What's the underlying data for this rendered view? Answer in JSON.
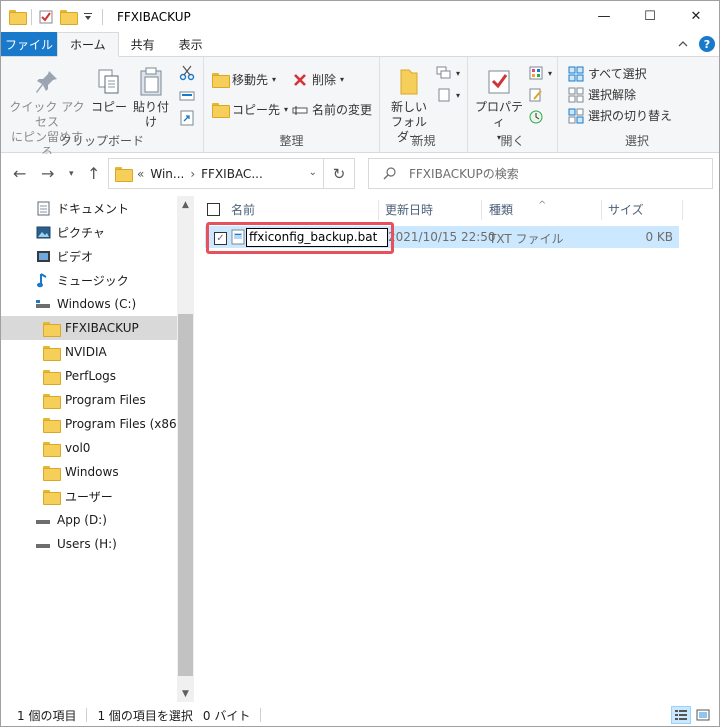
{
  "window": {
    "title": "FFXIBACKUP",
    "controls": {
      "minimize": "—",
      "maximize": "☐",
      "close": "✕"
    }
  },
  "tabs": [
    {
      "label": "ファイル"
    },
    {
      "label": "ホーム"
    },
    {
      "label": "共有"
    },
    {
      "label": "表示"
    }
  ],
  "ribbon": {
    "clipboard": {
      "label": "クリップボード",
      "pin_line1": "クイック アクセス",
      "pin_line2": "にピン留めする",
      "copy": "コピー",
      "paste": "貼り付け"
    },
    "organize": {
      "label": "整理",
      "move_to": "移動先",
      "copy_to": "コピー先",
      "delete": "削除",
      "rename": "名前の変更"
    },
    "new": {
      "label": "新規",
      "new_folder_line1": "新しい",
      "new_folder_line2": "フォルダー"
    },
    "open": {
      "label": "開く",
      "properties": "プロパティ"
    },
    "select": {
      "label": "選択",
      "select_all": "すべて選択",
      "select_none": "選択解除",
      "invert": "選択の切り替え"
    }
  },
  "address": {
    "segment1": "Win...",
    "segment2": "FFXIBAC...",
    "search_placeholder": "FFXIBACKUPの検索"
  },
  "nav": [
    {
      "label": "ドキュメント",
      "icon": "document-icon",
      "indent": 0
    },
    {
      "label": "ピクチャ",
      "icon": "pictures-icon",
      "indent": 0
    },
    {
      "label": "ビデオ",
      "icon": "video-icon",
      "indent": 0
    },
    {
      "label": "ミュージック",
      "icon": "music-icon",
      "indent": 0
    },
    {
      "label": "Windows (C:)",
      "icon": "drive-icon",
      "indent": 0
    },
    {
      "label": "FFXIBACKUP",
      "icon": "folder-icon",
      "indent": 1,
      "selected": true
    },
    {
      "label": "NVIDIA",
      "icon": "folder-icon",
      "indent": 1
    },
    {
      "label": "PerfLogs",
      "icon": "folder-icon",
      "indent": 1
    },
    {
      "label": "Program Files",
      "icon": "folder-icon",
      "indent": 1
    },
    {
      "label": "Program Files (x86)",
      "icon": "folder-icon",
      "indent": 1
    },
    {
      "label": "vol0",
      "icon": "folder-icon",
      "indent": 1
    },
    {
      "label": "Windows",
      "icon": "folder-icon",
      "indent": 1
    },
    {
      "label": "ユーザー",
      "icon": "folder-icon",
      "indent": 1
    },
    {
      "label": "App (D:)",
      "icon": "drive-icon",
      "indent": 0
    },
    {
      "label": "Users (H:)",
      "icon": "drive-icon",
      "indent": 0
    }
  ],
  "columns": {
    "name": "名前",
    "modified": "更新日時",
    "type": "種類",
    "size": "サイズ"
  },
  "file": {
    "name": "ffxiconfig_backup.bat",
    "modified": "2021/10/15 22:50",
    "type": "TXT ファイル",
    "size": "0 KB"
  },
  "status": {
    "count": "1 個の項目",
    "selected": "1 個の項目を選択",
    "size": "0 バイト"
  },
  "colors": {
    "accent": "#1979ca",
    "selection": "#cce8ff",
    "highlight": "#e8505b"
  }
}
